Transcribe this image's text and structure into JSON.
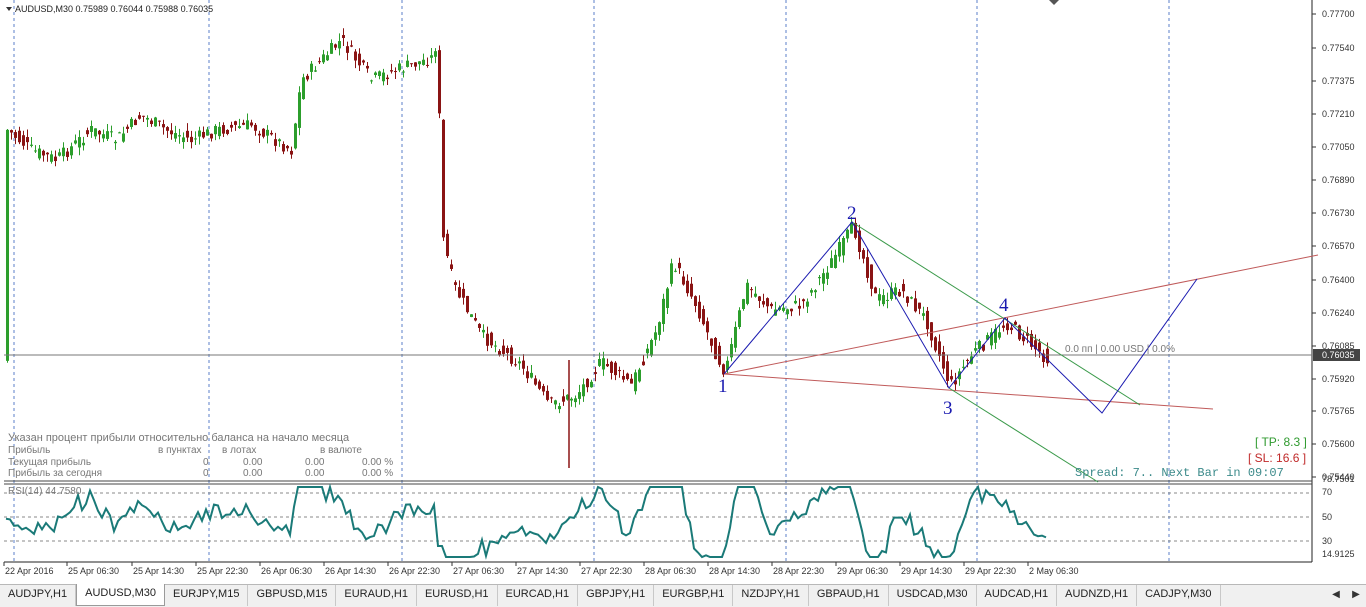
{
  "chart": {
    "title": "AUDUSD,M30  0.75989 0.76044 0.75988 0.76035",
    "current_price": "0.76035",
    "price_levels": [
      "0.77700",
      "0.77540",
      "0.77375",
      "0.77210",
      "0.77050",
      "0.76890",
      "0.76730",
      "0.76570",
      "0.76400",
      "0.76240",
      "0.76085",
      "0.75920",
      "0.75765",
      "0.75600",
      "0.75440"
    ],
    "time_labels": [
      "22 Apr 2016",
      "25 Apr 06:30",
      "25 Apr 14:30",
      "25 Apr 22:30",
      "26 Apr 06:30",
      "26 Apr 14:30",
      "26 Apr 22:30",
      "27 Apr 06:30",
      "27 Apr 14:30",
      "27 Apr 22:30",
      "28 Apr 06:30",
      "28 Apr 14:30",
      "28 Apr 22:30",
      "29 Apr 06:30",
      "29 Apr 14:30",
      "29 Apr 22:30",
      "2 May 06:30"
    ],
    "wave_labels": [
      "1",
      "2",
      "3",
      "4"
    ],
    "profit_line_label": "0.0 пп | 0.00 USD | 0.0%",
    "tp_label": "[ TP: 8.3 ]",
    "sl_label": "[ SL: 16.6 ]",
    "spread_label": "Spread: 7.. Next Bar in 09:07",
    "colors": {
      "bull": "#2c9e2c",
      "bear": "#8a1414",
      "wave": "#1a1ab0",
      "channel_red": "#c05a5a",
      "channel_green": "#3a9a4a",
      "grid": "#5b7fc8",
      "rsi": "#1a7a78"
    }
  },
  "profit_panel": {
    "heading": "Указан процент прибыли относительно баланса на начало месяца",
    "col_labels": [
      "Прибыль",
      "в пунктах",
      "в лотах",
      "в валюте"
    ],
    "rows": [
      {
        "label": "Текущая прибыль",
        "points": "0",
        "lots": "0.00",
        "money": "0.00",
        "pct": "0.00 %"
      },
      {
        "label": "Прибыль за сегодня",
        "points": "0",
        "lots": "0.00",
        "money": "0.00",
        "pct": "0.00 %"
      }
    ]
  },
  "rsi": {
    "title": "RSI(14) 44.7580",
    "levels": [
      "78.7501",
      "70",
      "50",
      "30",
      "14.9125"
    ]
  },
  "tabs": [
    "AUDJPY,H1",
    "AUDUSD,M30",
    "EURJPY,M15",
    "GBPUSD,M15",
    "EURAUD,H1",
    "EURUSD,H1",
    "EURCAD,H1",
    "GBPJPY,H1",
    "EURGBP,H1",
    "NZDJPY,H1",
    "GBPAUD,H1",
    "USDCAD,M30",
    "AUDCAD,H1",
    "AUDNZD,H1",
    "CADJPY,M30"
  ],
  "active_tab": "AUDUSD,M30"
}
